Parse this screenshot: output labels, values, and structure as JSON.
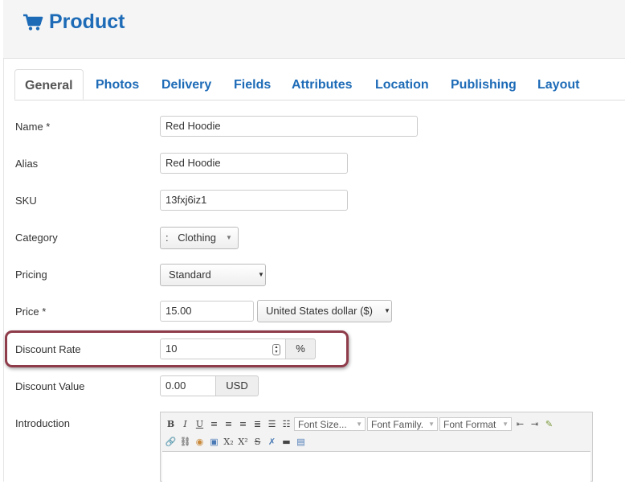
{
  "header": {
    "title": "Product",
    "icon": "cart-icon",
    "accent": "#1d6bb7"
  },
  "tabs": [
    {
      "label": "General",
      "active": true
    },
    {
      "label": "Photos"
    },
    {
      "label": "Delivery"
    },
    {
      "label": "Fields"
    },
    {
      "label": "Attributes"
    },
    {
      "label": "Location"
    },
    {
      "label": "Publishing"
    },
    {
      "label": "Layout"
    }
  ],
  "form": {
    "name": {
      "label": "Name *",
      "value": "Red Hoodie"
    },
    "alias": {
      "label": "Alias",
      "value": "Red Hoodie"
    },
    "sku": {
      "label": "SKU",
      "value": "13fxj6iz1"
    },
    "category": {
      "label": "Category",
      "prefix": ":",
      "value": "Clothing"
    },
    "pricing": {
      "label": "Pricing",
      "value": "Standard"
    },
    "price": {
      "label": "Price *",
      "value": "15.00",
      "currency": "United States dollar ($)"
    },
    "discount_rate": {
      "label": "Discount Rate",
      "value": "10",
      "unit": "%"
    },
    "discount_value": {
      "label": "Discount Value",
      "value": "0.00",
      "unit": "USD"
    },
    "introduction": {
      "label": "Introduction"
    }
  },
  "editor": {
    "font_size": "Font Size...",
    "font_family": "Font Family.",
    "font_format": "Font Format"
  },
  "highlight_color": "#8e3b4a"
}
